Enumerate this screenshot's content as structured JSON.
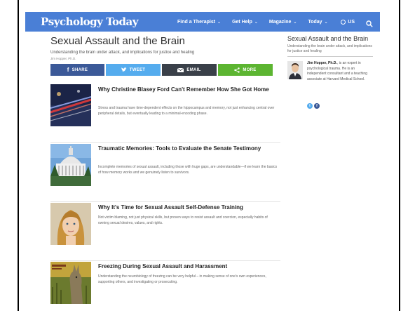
{
  "site": {
    "logo": "Psychology Today",
    "brand_color": "#4a7fd6",
    "nav": [
      {
        "label": "Find a Therapist"
      },
      {
        "label": "Get Help"
      },
      {
        "label": "Magazine"
      },
      {
        "label": "Today"
      }
    ],
    "region": "US",
    "icons": {
      "region": "globe-icon",
      "search": "search-icon"
    }
  },
  "blog": {
    "title": "Sexual Assault and the Brain",
    "subtitle": "Understanding the brain under attack, and implications for justice and healing",
    "author_line": "Jim Hopper, Ph.D."
  },
  "share": {
    "facebook": "SHARE",
    "twitter": "TWEET",
    "email": "EMAIL",
    "more": "MORE",
    "colors": {
      "facebook": "#3b5998",
      "twitter": "#55acee",
      "email": "#3a4049",
      "more": "#5cb531"
    }
  },
  "articles": [
    {
      "title": "Why Christine Blasey Ford Can't Remember How She Got Home",
      "description": "Stress and trauma have time-dependent effects on the hippocampus and memory, not just enhancing central over peripheral details, but eventually leading to a minimal-encoding phase."
    },
    {
      "title": "Traumatic Memories: Tools to Evaluate the Senate Testimony",
      "description": "Incomplete memories of sexual assault, including those with huge gaps, are understandable—if we learn the basics of how memory works and we genuinely listen to survivors."
    },
    {
      "title": "Why It's Time for Sexual Assault Self-Defense Training",
      "description": "Not victim blaming, not just physical skills, but proven ways to resist assault and coercion, especially habits of owning sexual desires, values, and rights."
    },
    {
      "title": "Freezing During Sexual Assault and Harassment",
      "description": "Understanding the neurobiology of freezing can be very helpful – in making sense of one's own experiences, supporting others, and investigating or prosecuting."
    }
  ],
  "sidebar": {
    "title": "Sexual Assault and the Brain",
    "subtitle": "Understanding the brain under attack, and implications for justice and healing",
    "author_name": "Jim Hopper, Ph.D.",
    "author_bio": ", is an expert in psychological trauma. He is an independent consultant and a teaching associate at Harvard Medical School.",
    "social": {
      "twitter": "t",
      "facebook": "f"
    }
  }
}
